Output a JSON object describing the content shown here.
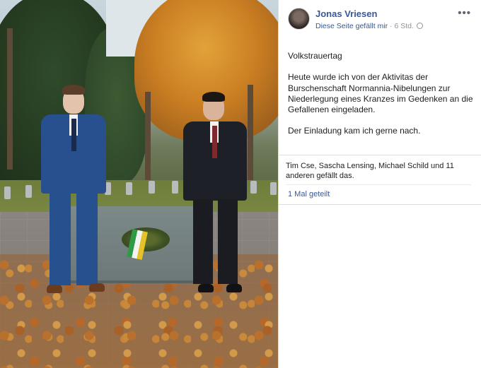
{
  "post": {
    "author": "Jonas Vriesen",
    "liked_page_text": "Diese Seite gefällt mir",
    "separator": " · ",
    "timestamp": "6 Std.",
    "more_icon": "more-options-icon",
    "privacy_icon": "globe-icon",
    "paragraphs": [
      "Volkstrauertag",
      "Heute wurde ich von der Aktivitas der Burschenschaft Normannia-Nibelungen zur Niederlegung eines Kranzes im Gedenken an die Gefallenen eingeladen.",
      "Der Einladung kam ich gerne nach."
    ],
    "likes_text": "Tim Cse, Sascha Lensing, Michael Schild und 11 anderen gefällt das.",
    "shares_text": "1 Mal geteilt"
  },
  "colors": {
    "link": "#385898",
    "muted": "#90949c",
    "divider": "#dddfe2"
  }
}
